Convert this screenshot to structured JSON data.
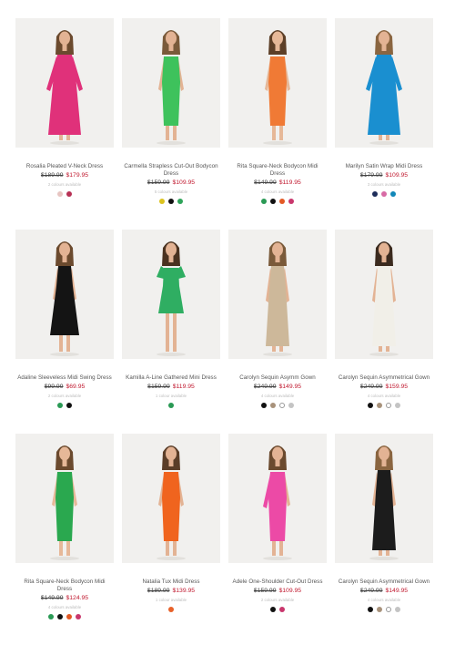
{
  "products": [
    {
      "name": "Rosalia Pleated V-Neck Dress",
      "was": "$189.99",
      "now": "$179.95",
      "avail": "2 colours available",
      "dress_color": "#e0317a",
      "dress_shape": "gown-sleeve",
      "skin": "#e3b394",
      "hair": "#6b4a2e",
      "swatches": [
        {
          "name": "blush-swatch",
          "color": "#e7c5c2"
        },
        {
          "name": "berry-swatch",
          "color": "#b73054"
        }
      ]
    },
    {
      "name": "Carmella Strapless Cut-Out Bodycon Dress",
      "was": "$159.99",
      "now": "$109.95",
      "avail": "5 colours available",
      "dress_color": "#3ec25c",
      "dress_shape": "bodycon",
      "skin": "#e3b394",
      "hair": "#7a5a3a",
      "swatches": [
        {
          "name": "yellow-swatch",
          "color": "#dcc31f"
        },
        {
          "name": "black-swatch",
          "color": "#111111"
        },
        {
          "name": "green-swatch",
          "color": "#2fa45a"
        }
      ]
    },
    {
      "name": "Rita Square-Neck Bodycon Midi Dress",
      "was": "$149.99",
      "now": "$119.95",
      "avail": "4 colours available",
      "dress_color": "#f07a35",
      "dress_shape": "bodycon",
      "skin": "#e6b898",
      "hair": "#5d3f27",
      "swatches": [
        {
          "name": "green-swatch",
          "color": "#2a9a55"
        },
        {
          "name": "black-swatch",
          "color": "#111111"
        },
        {
          "name": "orange-swatch",
          "color": "#e35a25"
        },
        {
          "name": "pink-swatch",
          "color": "#c9376d"
        }
      ]
    },
    {
      "name": "Marilyn Satin Wrap Midi Dress",
      "was": "$179.99",
      "now": "$109.95",
      "avail": "3 colours available",
      "dress_color": "#1a8fd0",
      "dress_shape": "gown-sleeve",
      "skin": "#e3b394",
      "hair": "#8a6540",
      "swatches": [
        {
          "name": "navy-swatch",
          "color": "#1d2d5a"
        },
        {
          "name": "pink-swatch",
          "color": "#d86aa5"
        },
        {
          "name": "teal-swatch",
          "color": "#1287b8"
        }
      ]
    },
    {
      "name": "Adaline Sleeveless Midi Swing Dress",
      "was": "$99.99",
      "now": "$69.95",
      "avail": "2 colours available",
      "dress_color": "#141414",
      "dress_shape": "swing",
      "skin": "#e3b394",
      "hair": "#6b4a2e",
      "swatches": [
        {
          "name": "green-swatch",
          "color": "#2a9a55"
        },
        {
          "name": "black-swatch",
          "color": "#111111"
        }
      ]
    },
    {
      "name": "Kamilla A-Line Gathered Mini Dress",
      "was": "$159.99",
      "now": "$119.95",
      "avail": "1 colour available",
      "dress_color": "#2fae62",
      "dress_shape": "mini",
      "skin": "#e3b394",
      "hair": "#4a3220",
      "swatches": [
        {
          "name": "green-swatch",
          "color": "#2a9a55"
        }
      ]
    },
    {
      "name": "Carolyn Sequin Asymm Gown",
      "was": "$249.99",
      "now": "$149.95",
      "avail": "4 colours available",
      "dress_color": "#cdb89a",
      "dress_shape": "gown",
      "skin": "#e3b394",
      "hair": "#7a5a3a",
      "swatches": [
        {
          "name": "black-swatch",
          "color": "#111111"
        },
        {
          "name": "taupe-swatch",
          "color": "#a8927b"
        },
        {
          "name": "white-swatch",
          "color": "#ffffff"
        },
        {
          "name": "silver-swatch",
          "color": "#c4c4c4"
        }
      ]
    },
    {
      "name": "Carolyn Sequin Asymmetrical Gown",
      "was": "$249.99",
      "now": "$159.95",
      "avail": "4 colours available",
      "dress_color": "#f1efe8",
      "dress_shape": "gown",
      "skin": "#e3b394",
      "hair": "#3b2a1e",
      "swatches": [
        {
          "name": "black-swatch",
          "color": "#111111"
        },
        {
          "name": "taupe-swatch",
          "color": "#a8927b"
        },
        {
          "name": "white-swatch",
          "color": "#ffffff"
        },
        {
          "name": "silver-swatch",
          "color": "#c4c4c4"
        }
      ]
    },
    {
      "name": "Rita Square-Neck Bodycon Midi Dress",
      "was": "$149.99",
      "now": "$124.95",
      "avail": "4 colours available",
      "dress_color": "#2aa84f",
      "dress_shape": "bodycon",
      "skin": "#e6b898",
      "hair": "#6b4a2e",
      "swatches": [
        {
          "name": "green-swatch",
          "color": "#2a9a55"
        },
        {
          "name": "black-swatch",
          "color": "#111111"
        },
        {
          "name": "orange-swatch",
          "color": "#e35a25"
        },
        {
          "name": "pink-swatch",
          "color": "#c9376d"
        }
      ]
    },
    {
      "name": "Natalia Tux Midi Dress",
      "was": "$189.99",
      "now": "$139.95",
      "avail": "1 colour available",
      "dress_color": "#f0641e",
      "dress_shape": "bodycon",
      "skin": "#e3b394",
      "hair": "#5a3d28",
      "swatches": [
        {
          "name": "orange-swatch",
          "color": "#e8622a"
        }
      ]
    },
    {
      "name": "Adele One-Shoulder Cut-Out Dress",
      "was": "$159.99",
      "now": "$109.95",
      "avail": "2 colours available",
      "dress_color": "#ec4aa6",
      "dress_shape": "bodycon-sleeve",
      "skin": "#e3b394",
      "hair": "#6b4a2e",
      "swatches": [
        {
          "name": "black-swatch",
          "color": "#111111"
        },
        {
          "name": "pink-swatch",
          "color": "#c9376d"
        }
      ]
    },
    {
      "name": "Carolyn Sequin Asymmetrical Gown",
      "was": "$249.99",
      "now": "$149.95",
      "avail": "4 colours available",
      "dress_color": "#1c1c1c",
      "dress_shape": "gown",
      "skin": "#e3b394",
      "hair": "#8a6540",
      "swatches": [
        {
          "name": "black-swatch",
          "color": "#111111"
        },
        {
          "name": "taupe-swatch",
          "color": "#a8927b"
        },
        {
          "name": "white-swatch",
          "color": "#ffffff"
        },
        {
          "name": "silver-swatch",
          "color": "#c4c4c4"
        }
      ]
    }
  ]
}
